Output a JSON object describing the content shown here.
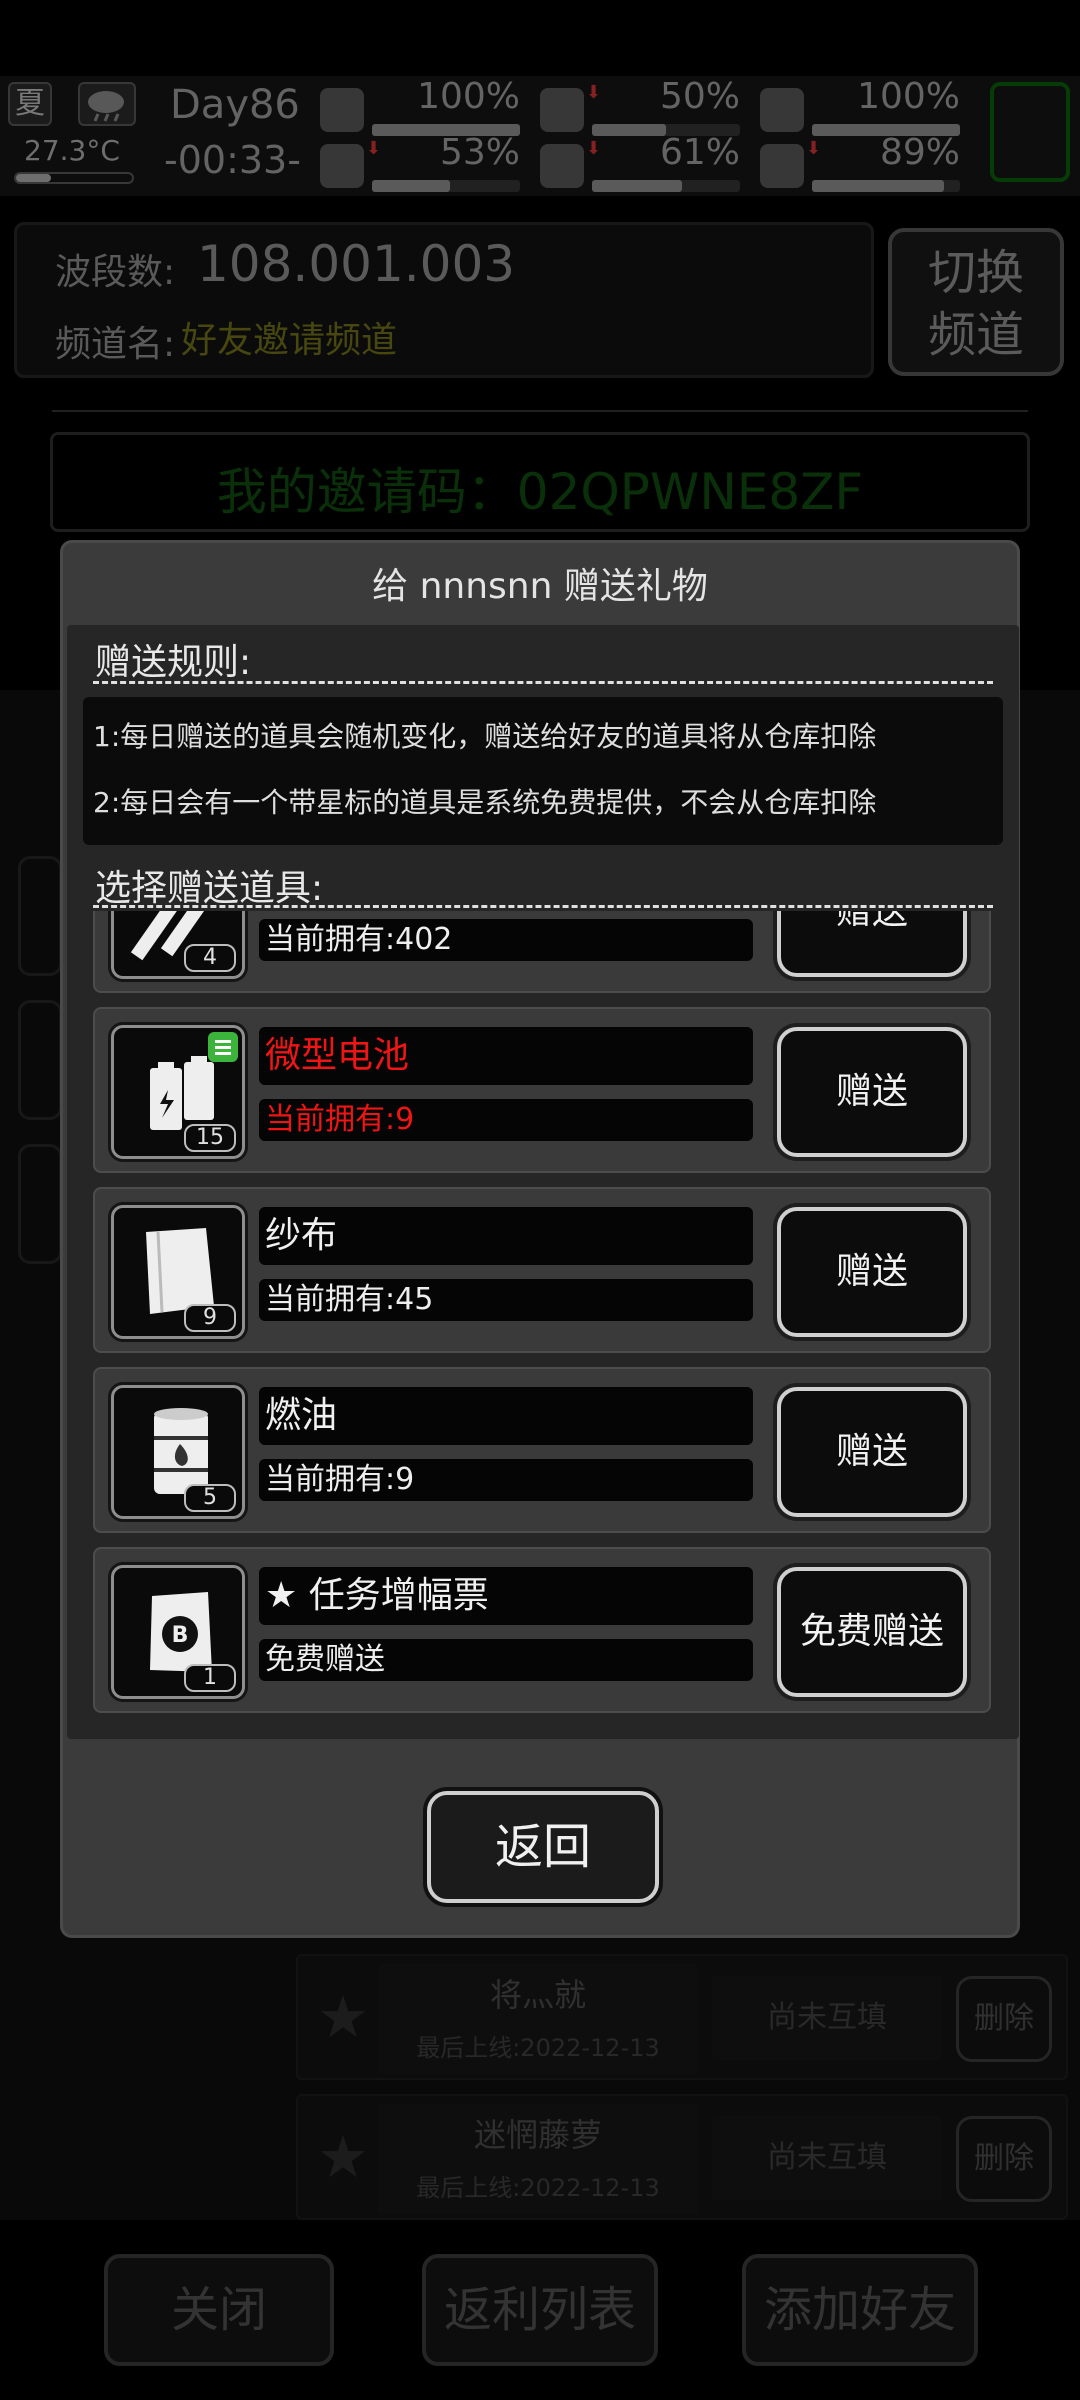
{
  "status": {
    "season": "夏",
    "temperature": "27.3°C",
    "day": "Day86",
    "clock": "-00:33-",
    "stats": [
      {
        "icon": "medkit-icon",
        "value": "100%",
        "fill": 1.0,
        "down": false
      },
      {
        "icon": "stomach-icon",
        "value": "50%",
        "fill": 0.5,
        "down": true
      },
      {
        "icon": "shield-icon",
        "value": "100%",
        "fill": 1.0,
        "down": false
      },
      {
        "icon": "boot-icon",
        "value": "53%",
        "fill": 0.53,
        "down": true
      },
      {
        "icon": "water-drop-icon",
        "value": "61%",
        "fill": 0.61,
        "down": true
      },
      {
        "icon": "heart-icon",
        "value": "89%",
        "fill": 0.89,
        "down": true
      }
    ]
  },
  "channel": {
    "band_label": "波段数:",
    "frequency": "108.001.003",
    "name_label": "频道名:",
    "name": "好友邀请频道",
    "switch_line1": "切换",
    "switch_line2": "频道"
  },
  "invite": {
    "code_text": "我的邀请码：02QPWNE8ZF"
  },
  "friends": [
    {
      "name": "将灬就",
      "last_online": "最后上线:2022-12-13",
      "state": "尚未互填",
      "delete": "删除"
    },
    {
      "name": "迷惘藤萝",
      "last_online": "最后上线:2022-12-13",
      "state": "尚未互填",
      "delete": "删除"
    }
  ],
  "bottom": {
    "close": "关闭",
    "rebate_list": "返利列表",
    "add_friend": "添加好友"
  },
  "dialog": {
    "title": "给 nnnsnn 赠送礼物",
    "rules_title": "赠送规则:",
    "rules": [
      "1:每日赠送的道具会随机变化，赠送给好友的道具将从仓库扣除",
      "2:每日会有一个带星标的道具是系统免费提供，不会从仓库扣除"
    ],
    "select_title": "选择赠送道具:",
    "items": [
      {
        "icon": "pen-icon",
        "name": "",
        "qty": "4",
        "owned": "当前拥有:402",
        "button": "赠送",
        "highlight": false
      },
      {
        "icon": "battery-icon",
        "name": "微型电池",
        "qty": "15",
        "owned": "当前拥有:9",
        "button": "赠送",
        "highlight": true
      },
      {
        "icon": "gauze-icon",
        "name": "纱布",
        "qty": "9",
        "owned": "当前拥有:45",
        "button": "赠送",
        "highlight": false
      },
      {
        "icon": "fuel-barrel-icon",
        "name": "燃油",
        "qty": "5",
        "owned": "当前拥有:9",
        "button": "赠送",
        "highlight": false
      },
      {
        "icon": "ticket-icon",
        "name": "★ 任务增幅票",
        "qty": "1",
        "owned": "免费赠送",
        "button": "免费赠送",
        "highlight": false
      }
    ],
    "back": "返回"
  }
}
